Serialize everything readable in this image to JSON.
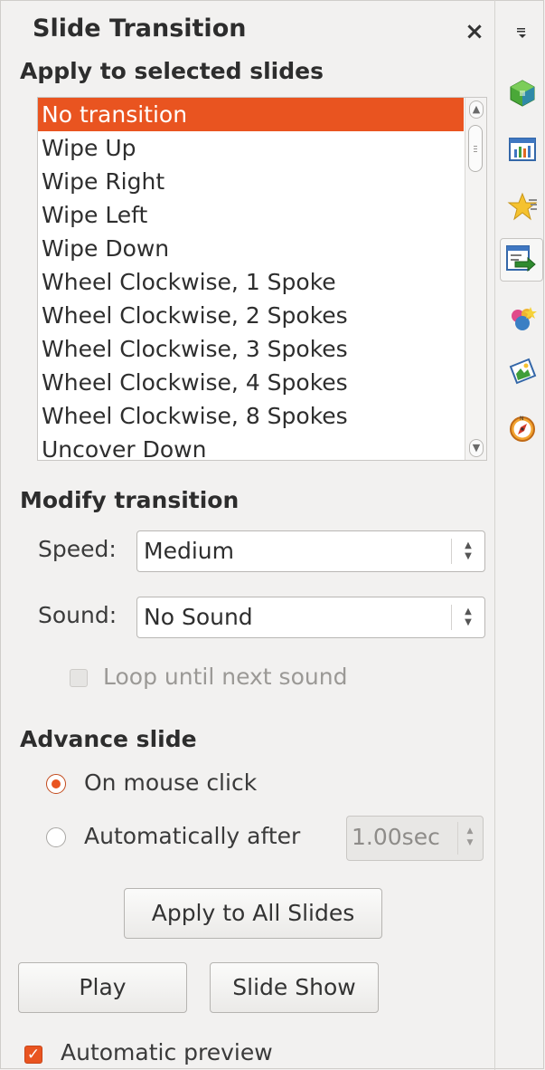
{
  "panel": {
    "title": "Slide Transition",
    "close_label": "×"
  },
  "apply_section": {
    "heading": "Apply to selected slides",
    "transitions": [
      "No transition",
      "Wipe Up",
      "Wipe Right",
      "Wipe Left",
      "Wipe Down",
      "Wheel Clockwise, 1 Spoke",
      "Wheel Clockwise, 2 Spokes",
      "Wheel Clockwise, 3 Spokes",
      "Wheel Clockwise, 4 Spokes",
      "Wheel Clockwise, 8 Spokes",
      "Uncover Down"
    ],
    "selected": "No transition"
  },
  "modify_section": {
    "heading": "Modify transition",
    "speed_label": "Speed:",
    "speed_value": "Medium",
    "sound_label": "Sound:",
    "sound_value": "No Sound",
    "loop_label": "Loop until next sound"
  },
  "advance_section": {
    "heading": "Advance slide",
    "on_click_label": "On mouse click",
    "auto_label": "Automatically after",
    "auto_value": "1.00sec"
  },
  "buttons": {
    "apply_all": "Apply to All Slides",
    "play": "Play",
    "slide_show": "Slide Show"
  },
  "preview": {
    "label": "Automatic preview"
  },
  "sidebar": {
    "icons": [
      "properties-icon",
      "master-slides-icon",
      "custom-animation-icon",
      "slide-transition-icon",
      "styles-icon",
      "gallery-icon",
      "navigator-icon"
    ]
  }
}
